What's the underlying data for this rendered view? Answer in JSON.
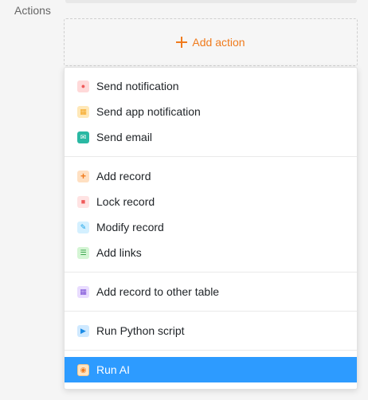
{
  "section": {
    "label": "Actions"
  },
  "add_action": {
    "label": "Add action",
    "icon": "plus-icon",
    "color": "#f07b1d"
  },
  "menu": {
    "groups": [
      {
        "items": [
          {
            "label": "Send notification",
            "icon": "bell-icon"
          },
          {
            "label": "Send app notification",
            "icon": "app-grid-icon"
          },
          {
            "label": "Send email",
            "icon": "envelope-icon"
          }
        ]
      },
      {
        "items": [
          {
            "label": "Add record",
            "icon": "plus-icon"
          },
          {
            "label": "Lock record",
            "icon": "lock-icon"
          },
          {
            "label": "Modify record",
            "icon": "pencil-icon"
          },
          {
            "label": "Add links",
            "icon": "links-list-icon"
          }
        ]
      },
      {
        "items": [
          {
            "label": "Add record to other table",
            "icon": "table-add-icon"
          }
        ]
      },
      {
        "items": [
          {
            "label": "Run Python script",
            "icon": "play-circle-icon"
          }
        ]
      },
      {
        "items": [
          {
            "label": "Run AI",
            "icon": "ai-icon",
            "active": true
          }
        ]
      }
    ],
    "active_color": "#2d9bff"
  }
}
